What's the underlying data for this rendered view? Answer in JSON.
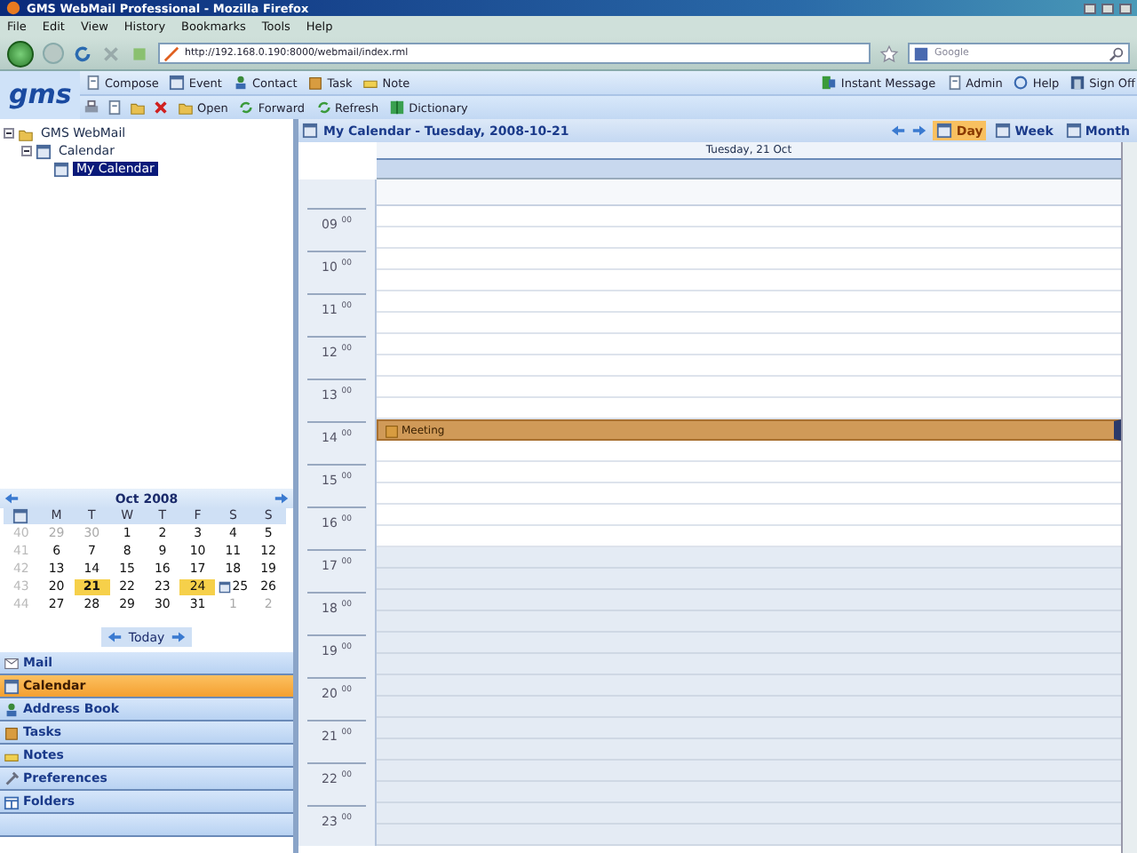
{
  "window": {
    "title": "GMS WebMail Professional - Mozilla Firefox"
  },
  "menu": [
    "File",
    "Edit",
    "View",
    "History",
    "Bookmarks",
    "Tools",
    "Help"
  ],
  "address_bar": {
    "value": "http://192.168.0.190:8000/webmail/index.rml"
  },
  "search": {
    "placeholder": "Google"
  },
  "app": {
    "logo": "gms",
    "new_items": [
      "Compose",
      "Event",
      "Contact",
      "Task",
      "Note"
    ],
    "actions": [
      "Open",
      "Forward",
      "Refresh",
      "Dictionary"
    ],
    "header_links": [
      "Instant Message",
      "Admin",
      "Help",
      "Sign Off"
    ]
  },
  "tree": [
    {
      "label": "GMS WebMail",
      "expanded": true,
      "selected": false,
      "children": [
        {
          "label": "Calendar",
          "expanded": true,
          "selected": false,
          "children": [
            {
              "label": "My Calendar",
              "selected": true
            }
          ]
        }
      ]
    }
  ],
  "mini_calendar": {
    "title": "Oct 2008",
    "weekdays": [
      "M",
      "T",
      "W",
      "T",
      "F",
      "S",
      "S"
    ],
    "today_button": "Today",
    "weeks": [
      {
        "week": "40",
        "days": [
          {
            "text": "29",
            "muted": true,
            "selected": false,
            "highlighted": false,
            "marked": false
          },
          {
            "text": "30",
            "muted": true,
            "selected": false,
            "highlighted": false,
            "marked": false
          },
          {
            "text": "1",
            "muted": false,
            "selected": false,
            "highlighted": false,
            "marked": false
          },
          {
            "text": "2",
            "muted": false,
            "selected": false,
            "highlighted": false,
            "marked": false
          },
          {
            "text": "3",
            "muted": false,
            "selected": false,
            "highlighted": false,
            "marked": false
          },
          {
            "text": "4",
            "muted": false,
            "selected": false,
            "highlighted": false,
            "marked": false
          },
          {
            "text": "5",
            "muted": false,
            "selected": false,
            "highlighted": false,
            "marked": false
          }
        ]
      },
      {
        "week": "41",
        "days": [
          {
            "text": "6",
            "muted": false,
            "selected": false,
            "highlighted": false,
            "marked": false
          },
          {
            "text": "7",
            "muted": false,
            "selected": false,
            "highlighted": false,
            "marked": false
          },
          {
            "text": "8",
            "muted": false,
            "selected": false,
            "highlighted": false,
            "marked": false
          },
          {
            "text": "9",
            "muted": false,
            "selected": false,
            "highlighted": false,
            "marked": false
          },
          {
            "text": "10",
            "muted": false,
            "selected": false,
            "highlighted": false,
            "marked": false
          },
          {
            "text": "11",
            "muted": false,
            "selected": false,
            "highlighted": false,
            "marked": false
          },
          {
            "text": "12",
            "muted": false,
            "selected": false,
            "highlighted": false,
            "marked": false
          }
        ]
      },
      {
        "week": "42",
        "days": [
          {
            "text": "13",
            "muted": false,
            "selected": false,
            "highlighted": false,
            "marked": false
          },
          {
            "text": "14",
            "muted": false,
            "selected": false,
            "highlighted": false,
            "marked": false
          },
          {
            "text": "15",
            "muted": false,
            "selected": false,
            "highlighted": false,
            "marked": false
          },
          {
            "text": "16",
            "muted": false,
            "selected": false,
            "highlighted": false,
            "marked": false
          },
          {
            "text": "17",
            "muted": false,
            "selected": false,
            "highlighted": false,
            "marked": false
          },
          {
            "text": "18",
            "muted": false,
            "selected": false,
            "highlighted": false,
            "marked": false
          },
          {
            "text": "19",
            "muted": false,
            "selected": false,
            "highlighted": false,
            "marked": false
          }
        ]
      },
      {
        "week": "43",
        "days": [
          {
            "text": "20",
            "muted": false,
            "selected": false,
            "highlighted": false,
            "marked": false
          },
          {
            "text": "21",
            "muted": false,
            "selected": true,
            "highlighted": true,
            "marked": false
          },
          {
            "text": "22",
            "muted": false,
            "selected": false,
            "highlighted": false,
            "marked": false
          },
          {
            "text": "23",
            "muted": false,
            "selected": false,
            "highlighted": false,
            "marked": false
          },
          {
            "text": "24",
            "muted": false,
            "selected": false,
            "highlighted": true,
            "marked": false
          },
          {
            "text": "25",
            "muted": false,
            "selected": false,
            "highlighted": false,
            "marked": true
          },
          {
            "text": "26",
            "muted": false,
            "selected": false,
            "highlighted": false,
            "marked": false
          }
        ]
      },
      {
        "week": "44",
        "days": [
          {
            "text": "27",
            "muted": false,
            "selected": false,
            "highlighted": false,
            "marked": false
          },
          {
            "text": "28",
            "muted": false,
            "selected": false,
            "highlighted": false,
            "marked": false
          },
          {
            "text": "29",
            "muted": false,
            "selected": false,
            "highlighted": false,
            "marked": false
          },
          {
            "text": "30",
            "muted": false,
            "selected": false,
            "highlighted": false,
            "marked": false
          },
          {
            "text": "31",
            "muted": false,
            "selected": false,
            "highlighted": false,
            "marked": false
          },
          {
            "text": "1",
            "muted": true,
            "selected": false,
            "highlighted": false,
            "marked": false
          },
          {
            "text": "2",
            "muted": true,
            "selected": false,
            "highlighted": false,
            "marked": false
          }
        ]
      }
    ]
  },
  "nav": [
    {
      "label": "Mail",
      "selected": false
    },
    {
      "label": "Calendar",
      "selected": true
    },
    {
      "label": "Address Book",
      "selected": false
    },
    {
      "label": "Tasks",
      "selected": false
    },
    {
      "label": "Notes",
      "selected": false
    },
    {
      "label": "Preferences",
      "selected": false
    },
    {
      "label": "Folders",
      "selected": false
    }
  ],
  "calendar": {
    "title": "My Calendar - Tuesday, 2008-10-21",
    "views": [
      {
        "label": "Day",
        "selected": true
      },
      {
        "label": "Week",
        "selected": false
      },
      {
        "label": "Month",
        "selected": false
      }
    ],
    "day_heading": "Tuesday, 21 Oct",
    "hours": [
      {
        "hour": "09",
        "minutes": "00",
        "off_hours": false
      },
      {
        "hour": "10",
        "minutes": "00",
        "off_hours": false
      },
      {
        "hour": "11",
        "minutes": "00",
        "off_hours": false
      },
      {
        "hour": "12",
        "minutes": "00",
        "off_hours": false
      },
      {
        "hour": "13",
        "minutes": "00",
        "off_hours": false
      },
      {
        "hour": "14",
        "minutes": "00",
        "off_hours": false,
        "event": "Meeting"
      },
      {
        "hour": "15",
        "minutes": "00",
        "off_hours": false
      },
      {
        "hour": "16",
        "minutes": "00",
        "off_hours": false
      },
      {
        "hour": "17",
        "minutes": "00",
        "off_hours": true
      },
      {
        "hour": "18",
        "minutes": "00",
        "off_hours": true
      },
      {
        "hour": "19",
        "minutes": "00",
        "off_hours": true
      },
      {
        "hour": "20",
        "minutes": "00",
        "off_hours": true
      },
      {
        "hour": "21",
        "minutes": "00",
        "off_hours": true
      },
      {
        "hour": "22",
        "minutes": "00",
        "off_hours": true
      },
      {
        "hour": "23",
        "minutes": "00",
        "off_hours": true
      }
    ]
  }
}
